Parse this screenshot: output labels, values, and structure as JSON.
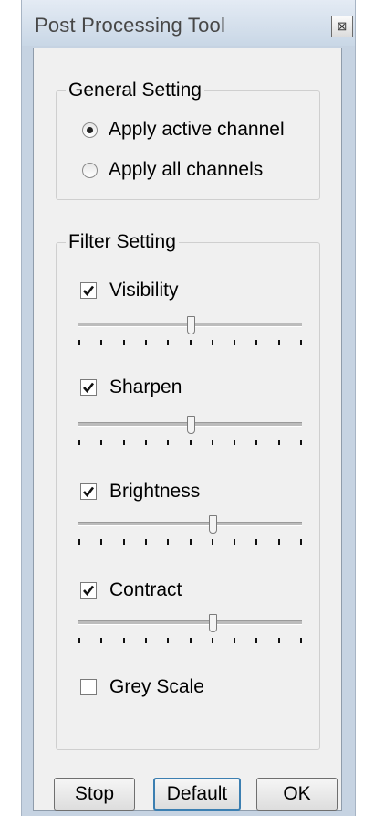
{
  "window": {
    "title": "Post Processing Tool",
    "close_glyph": "⊠"
  },
  "general": {
    "legend": "General Setting",
    "options": [
      {
        "label": "Apply active channel",
        "selected": true
      },
      {
        "label": "Apply all channels",
        "selected": false
      }
    ]
  },
  "filters": {
    "legend": "Filter Setting",
    "items": [
      {
        "label": "Visibility",
        "checked": true,
        "level": 0.5
      },
      {
        "label": "Sharpen",
        "checked": true,
        "level": 0.5
      },
      {
        "label": "Brightness",
        "checked": true,
        "level": 0.6
      },
      {
        "label": "Contract",
        "checked": true,
        "level": 0.6
      }
    ],
    "tick_count": 11,
    "grey_scale": {
      "label": "Grey Scale",
      "checked": false
    }
  },
  "buttons": {
    "stop": "Stop",
    "default": "Default",
    "ok": "OK"
  }
}
